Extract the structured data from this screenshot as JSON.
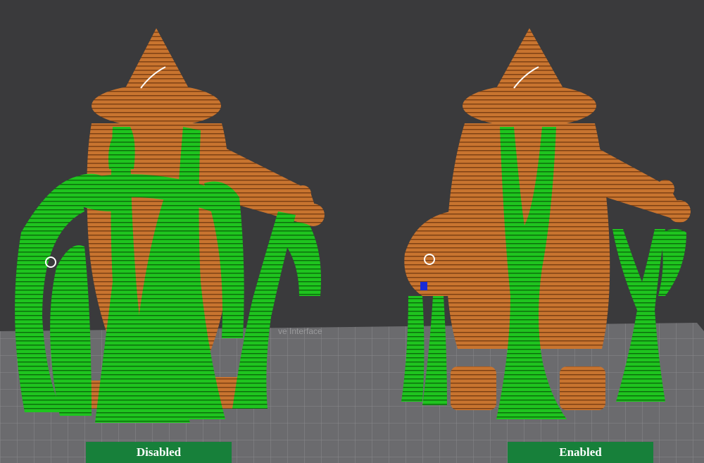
{
  "scene": {
    "background_color": "#3a3a3c",
    "bed_color": "#6b6b6e",
    "grid_color": "#8a8a8c",
    "model_color": "#c8742f",
    "support_color": "#1fc41f",
    "bed_text": "ve Interface"
  },
  "panels": [
    {
      "label": "Disabled",
      "support_style": "dense-tree"
    },
    {
      "label": "Enabled",
      "support_style": "sparse-tree"
    }
  ]
}
